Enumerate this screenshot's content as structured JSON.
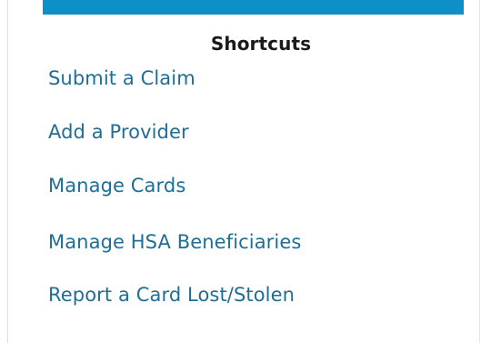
{
  "shortcuts": {
    "title": "Shortcuts",
    "links": [
      {
        "label": "Submit a Claim"
      },
      {
        "label": "Add a Provider"
      },
      {
        "label": "Manage Cards"
      },
      {
        "label": "Manage HSA Beneficiaries"
      },
      {
        "label": "Report a Card Lost/Stolen"
      }
    ]
  },
  "colors": {
    "top_bar": "#0f8fc7",
    "link": "#1e6e96",
    "title": "#1a1a1a"
  }
}
